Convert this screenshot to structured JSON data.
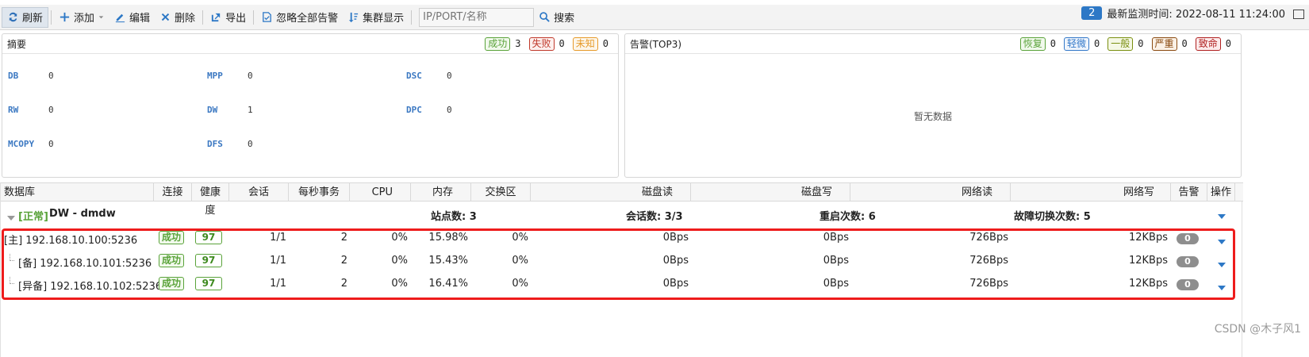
{
  "toolbar": {
    "refresh": "刷新",
    "add": "添加",
    "edit": "编辑",
    "delete": "删除",
    "export": "导出",
    "ignore_all": "忽略全部告警",
    "cluster_view": "集群显示",
    "search_placeholder": "IP/PORT/名称",
    "search": "搜索",
    "count_badge": "2",
    "last_check": "最新监测时间: 2022-08-11 11:24:00"
  },
  "summary": {
    "title": "摘要",
    "success_label": "成功",
    "success_count": "3",
    "fail_label": "失败",
    "fail_count": "0",
    "unknown_label": "未知",
    "unknown_count": "0",
    "items": [
      {
        "key": "DB",
        "value": "0"
      },
      {
        "key": "MPP",
        "value": "0"
      },
      {
        "key": "DSC",
        "value": "0"
      },
      {
        "key": "RW",
        "value": "0"
      },
      {
        "key": "DW",
        "value": "1"
      },
      {
        "key": "DPC",
        "value": "0"
      },
      {
        "key": "MCOPY",
        "value": "0"
      },
      {
        "key": "DFS",
        "value": "0"
      }
    ]
  },
  "alerts": {
    "title": "告警(TOP3)",
    "recover_label": "恢复",
    "recover_count": "0",
    "minor_label": "轻微",
    "minor_count": "0",
    "normal_label": "一般",
    "normal_count": "0",
    "serious_label": "严重",
    "serious_count": "0",
    "fatal_label": "致命",
    "fatal_count": "0",
    "empty": "暂无数据"
  },
  "table": {
    "headers": [
      "数据库",
      "连接",
      "健康度",
      "会话",
      "每秒事务",
      "CPU",
      "内存",
      "交换区",
      "磁盘读",
      "磁盘写",
      "网络读",
      "网络写",
      "告警",
      "操作"
    ],
    "group": {
      "status": "[正常]",
      "name": "DW - dmdw",
      "sites": "站点数: 3",
      "sessions": "会话数: 3/3",
      "restarts": "重启次数: 6",
      "failovers": "故障切换次数: 5"
    },
    "rows": [
      {
        "name": "[主] 192.168.10.100:5236",
        "conn": "成功",
        "health": "97",
        "session": "1/1",
        "tps": "2",
        "cpu": "0%",
        "mem": "15.98%",
        "swap": "0%",
        "disk_r": "0Bps",
        "disk_w": "0Bps",
        "net_r": "726Bps",
        "net_w": "12KBps",
        "alarm": "0"
      },
      {
        "name": "[备] 192.168.10.101:5236",
        "conn": "成功",
        "health": "97",
        "session": "1/1",
        "tps": "2",
        "cpu": "0%",
        "mem": "15.43%",
        "swap": "0%",
        "disk_r": "0Bps",
        "disk_w": "0Bps",
        "net_r": "726Bps",
        "net_w": "12KBps",
        "alarm": "0"
      },
      {
        "name": "[异备] 192.168.10.102:5236",
        "conn": "成功",
        "health": "97",
        "session": "1/1",
        "tps": "2",
        "cpu": "0%",
        "mem": "16.41%",
        "swap": "0%",
        "disk_r": "0Bps",
        "disk_w": "0Bps",
        "net_r": "726Bps",
        "net_w": "12KBps",
        "alarm": "0"
      }
    ]
  },
  "watermark": "CSDN @木子风1"
}
